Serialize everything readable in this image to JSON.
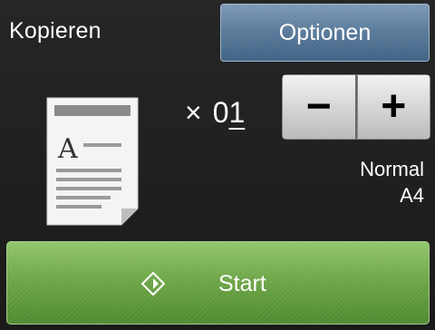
{
  "screen": {
    "title": "Kopieren"
  },
  "options_button": {
    "label": "Optionen"
  },
  "copies": {
    "prefix": "×",
    "count_first": "0",
    "count_cursor": "1"
  },
  "stepper": {
    "minus_symbol": "−",
    "plus_symbol": "+"
  },
  "settings": {
    "quality": "Normal",
    "paper": "A4"
  },
  "document_icon": {
    "letter": "A",
    "icon": "document-icon"
  },
  "start_button": {
    "label": "Start",
    "icon": "start-diamond-icon"
  },
  "colors": {
    "options_blue": "#5b7b9b",
    "start_green": "#6aa344",
    "background": "#1d1d1d"
  }
}
